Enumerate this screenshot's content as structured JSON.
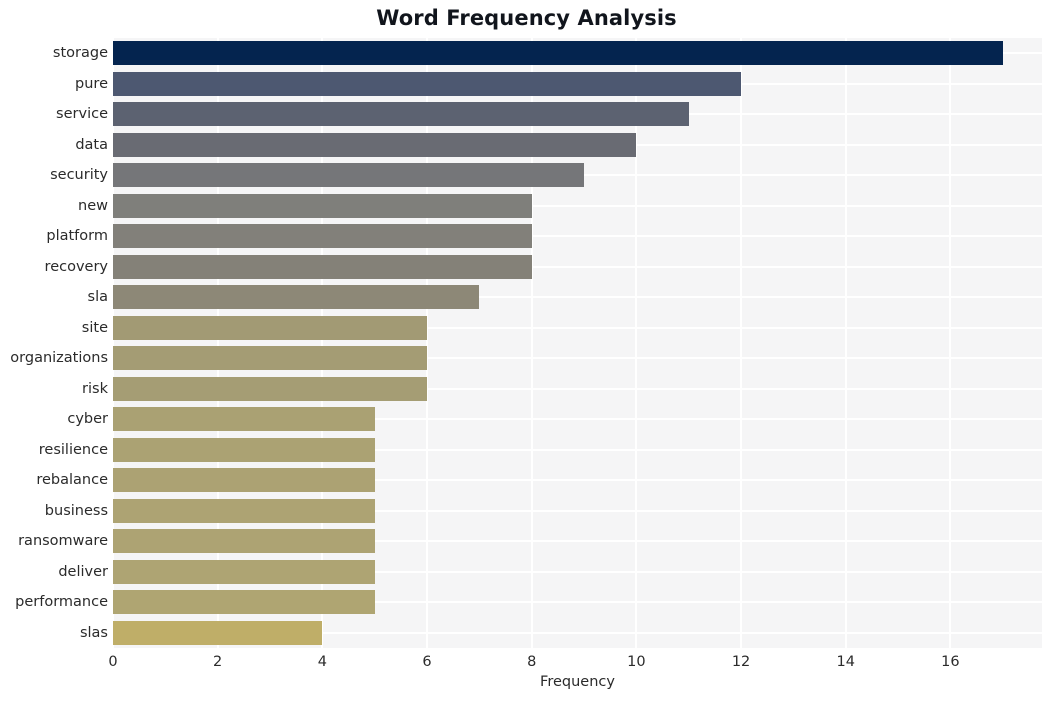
{
  "chart_data": {
    "type": "bar",
    "orientation": "horizontal",
    "title": "Word Frequency Analysis",
    "xlabel": "Frequency",
    "ylabel": "",
    "categories": [
      "storage",
      "pure",
      "service",
      "data",
      "security",
      "new",
      "platform",
      "recovery",
      "sla",
      "site",
      "organizations",
      "risk",
      "cyber",
      "resilience",
      "rebalance",
      "business",
      "ransomware",
      "deliver",
      "performance",
      "slas"
    ],
    "values": [
      17,
      12,
      11,
      10,
      9,
      8,
      8,
      8,
      7,
      6,
      6,
      6,
      5,
      5,
      5,
      5,
      5,
      5,
      5,
      4
    ],
    "bar_colors": [
      "#04244f",
      "#4d5871",
      "#5c6271",
      "#696b73",
      "#757679",
      "#7f7f7b",
      "#82807a",
      "#848178",
      "#8d8877",
      "#a29a74",
      "#a49c74",
      "#a59d74",
      "#aaa173",
      "#aba273",
      "#aca273",
      "#ada373",
      "#ada373",
      "#aea473",
      "#afa572",
      "#bfae68"
    ],
    "xlim": [
      0,
      17.75
    ],
    "xticks": [
      0,
      2,
      4,
      6,
      8,
      10,
      12,
      14,
      16
    ],
    "xticklabels": [
      "0",
      "2",
      "4",
      "6",
      "8",
      "10",
      "12",
      "14",
      "16"
    ],
    "grid": true,
    "grid_color": "#ffffff",
    "plot_background": "#f5f5f6",
    "figure_background": "#ffffff",
    "legend": null,
    "style": "whitegrid"
  }
}
